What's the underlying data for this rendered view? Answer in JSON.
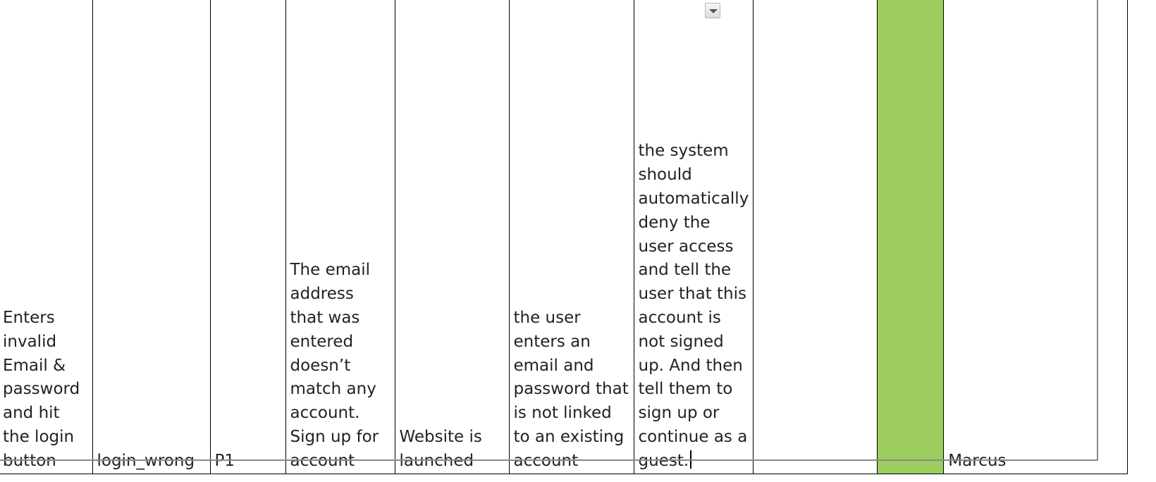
{
  "row": {
    "scenario": "Enters invalid Email & password and hit the login button",
    "test_case_id": "login_wrong",
    "priority": "P1",
    "description": "The email address that was entered doesn’t match any account. Sign up for account",
    "precondition": "Website is launched",
    "steps": "the user enters an email and password that is not linked to an existing account",
    "expected_result": "the system should automatically deny the user access and tell the user that this account is not signed up. And then tell them to sign up or continue as a guest.",
    "actual_result": "",
    "status": "",
    "owner": "Marcus"
  },
  "colors": {
    "status_fill": "#9ccd5e",
    "grid_lines": "#000000"
  },
  "icons": {
    "dropdown": "chevron-down-icon"
  }
}
